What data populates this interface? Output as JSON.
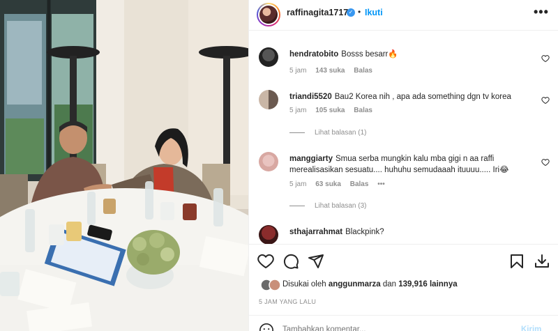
{
  "post": {
    "username": "raffinagita1717",
    "separator": "•",
    "follow_label": "Ikuti",
    "more_label": "•••"
  },
  "comments": [
    {
      "user": "hendratobito",
      "text": "Bosss besarr🔥",
      "time": "5 jam",
      "likes": "143 suka",
      "reply": "Balas"
    },
    {
      "user": "triandi5520",
      "text": "Bau2 Korea nih , apa ada something dgn tv korea",
      "time": "5 jam",
      "likes": "105 suka",
      "reply": "Balas",
      "view_replies": "Lihat balasan (1)"
    },
    {
      "user": "manggiarty",
      "text": "Smua serba mungkin kalu mba gigi n aa raffi merealisasikan sesuatu.... huhuhu semudaaah ituuuu..... Iri😂",
      "time": "5 jam",
      "likes": "63 suka",
      "reply": "Balas",
      "options": "•••",
      "view_replies": "Lihat balasan (3)"
    },
    {
      "user": "sthajarrahmat",
      "text": "Blackpink?"
    }
  ],
  "likes": {
    "prefix": "Disukai oleh",
    "user": "anggunmarza",
    "and": "dan",
    "count": "139,916 lainnya"
  },
  "timestamp": "5 JAM YANG LALU",
  "add_comment": {
    "placeholder": "Tambahkan komentar...",
    "post_label": "Kirim"
  },
  "icons": {
    "like": "heart-icon",
    "comment": "comment-icon",
    "share": "share-icon",
    "save": "bookmark-icon",
    "download": "download-icon"
  },
  "colors": {
    "accent": "#0095f6",
    "verified": "#3897f0",
    "text": "#262626",
    "muted": "#8e8e8e"
  }
}
